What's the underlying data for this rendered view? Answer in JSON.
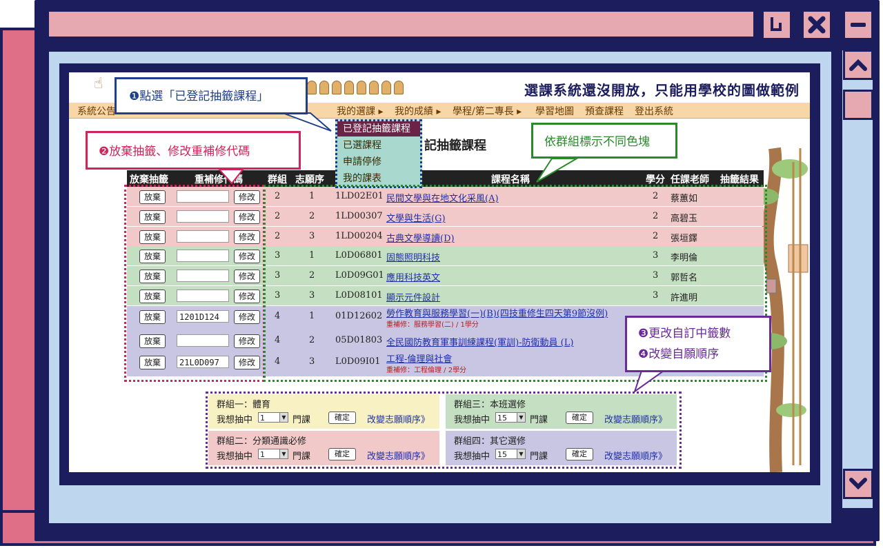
{
  "notice": "選課系統還沒開放，只能用學校的圖做範例",
  "menu": {
    "system_notice": "系統公告",
    "my_selection": "我的選課",
    "my_grades": "我的成績",
    "programs": "學程/第二專長",
    "learning_map": "學習地圖",
    "preview_courses": "預查課程",
    "logout": "登出系統"
  },
  "dropdown": {
    "items": [
      "已登記抽籤課程",
      "已選課程",
      "申請停修",
      "我的課表"
    ]
  },
  "page_heading": "記抽籤課程",
  "table": {
    "headers": {
      "give_up": "放棄抽籤",
      "retake": "重補修代碼",
      "group": "群組",
      "preference": "志願序",
      "course_name": "課程名稱",
      "credits": "學分",
      "teacher": "任課老師",
      "result": "抽籤結果"
    },
    "give_up_label": "放棄",
    "modify_label": "修改",
    "rows": [
      {
        "group": "2",
        "pref": "1",
        "code": "1LD02E01",
        "name": "民間文學與在地文化采風(A)",
        "credits": "2",
        "teacher": "蔡蕙如",
        "retake": "",
        "note": ""
      },
      {
        "group": "2",
        "pref": "2",
        "code": "1LD00307",
        "name": "文學與生活(G)",
        "credits": "2",
        "teacher": "高碧玉",
        "retake": "",
        "note": ""
      },
      {
        "group": "2",
        "pref": "3",
        "code": "1LD00204",
        "name": "古典文學導讀(D)",
        "credits": "2",
        "teacher": "張垣鐸",
        "retake": "",
        "note": ""
      },
      {
        "group": "3",
        "pref": "1",
        "code": "L0D06801",
        "name": "固態照明科技",
        "credits": "3",
        "teacher": "李明倫",
        "retake": "",
        "note": ""
      },
      {
        "group": "3",
        "pref": "2",
        "code": "L0D09G01",
        "name": "應用科技英文",
        "credits": "3",
        "teacher": "郭哲名",
        "retake": "",
        "note": ""
      },
      {
        "group": "3",
        "pref": "3",
        "code": "L0D08101",
        "name": "顯示元件設計",
        "credits": "3",
        "teacher": "許進明",
        "retake": "",
        "note": ""
      },
      {
        "group": "4",
        "pref": "1",
        "code": "01D12602",
        "name": "勞作教育與服務學習(一)(B)(四技重修生四天第9節沒例)",
        "credits": "",
        "teacher": "",
        "retake": "1201D124",
        "note": "重補修：服務學習(二) / 1學分"
      },
      {
        "group": "4",
        "pref": "2",
        "code": "05D01803",
        "name": "全民國防教育軍事訓練課程(軍訓)-防衛動員 (L)",
        "credits": "",
        "teacher": "",
        "retake": "",
        "note": ""
      },
      {
        "group": "4",
        "pref": "3",
        "code": "L0D09I01",
        "name": "工程-倫理與社會",
        "credits": "",
        "teacher": "",
        "retake": "21L0D097",
        "note": "重補修：工程倫理 / 2學分"
      }
    ]
  },
  "groups": [
    {
      "title": "群組一：體育",
      "label": "我想抽中",
      "value": "1",
      "unit": "門課",
      "confirm": "確定",
      "order": "改變志願順序》"
    },
    {
      "title": "群組三：本班選修",
      "label": "我想抽中",
      "value": "15",
      "unit": "門課",
      "confirm": "確定",
      "order": "改變志願順序》"
    },
    {
      "title": "群組二：分類通識必修",
      "label": "我想抽中",
      "value": "1",
      "unit": "門課",
      "confirm": "確定",
      "order": "改變志願順序》"
    },
    {
      "title": "群組四：其它選修",
      "label": "我想抽中",
      "value": "15",
      "unit": "門課",
      "confirm": "確定",
      "order": "改變志願順序》"
    }
  ],
  "annotations": {
    "step1": "❶點選「已登記抽籤課程」",
    "step2": "❷放棄抽籤、修改重補修代碼",
    "groups_note": "依群組標示不同色塊",
    "step3": "❸更改自訂中籤數",
    "step4": "❹改變自願順序"
  },
  "colors": {
    "frame_navy": "#1b1d5c",
    "frame_pink": "#de6f87",
    "light_pink": "#e7a9b1",
    "light_blue": "#bfd6ef",
    "group2_bg": "#f2c9c9",
    "group3_bg": "#c4dfc1",
    "group4_bg": "#c8c6e2",
    "callout_blue": "#1f3f8a",
    "callout_red": "#d0245a",
    "callout_green": "#2a8a2a",
    "callout_purple": "#6a2a9a"
  }
}
